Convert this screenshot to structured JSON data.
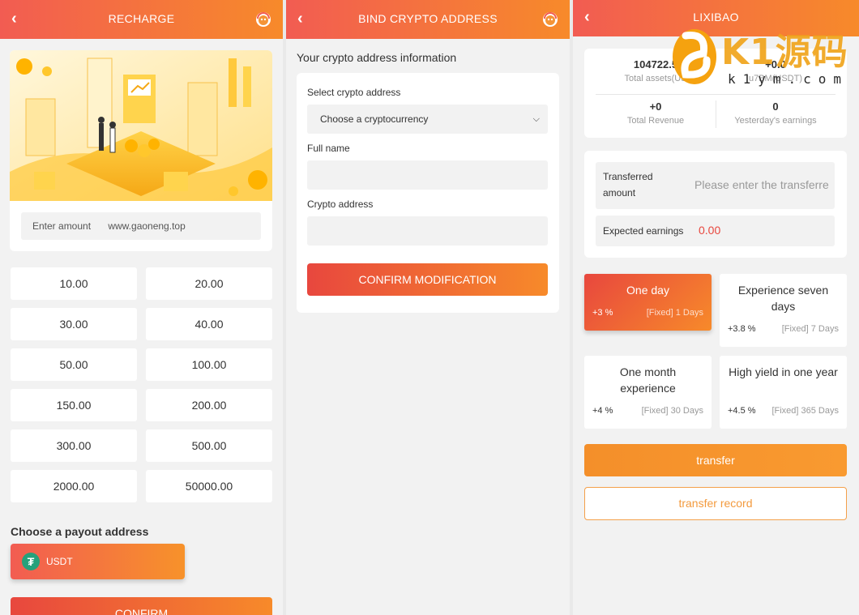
{
  "recharge": {
    "title": "RECHARGE",
    "amount_label": "Enter amount",
    "amount_value": "www.gaoneng.top",
    "amounts": [
      "10.00",
      "20.00",
      "30.00",
      "40.00",
      "50.00",
      "100.00",
      "150.00",
      "200.00",
      "300.00",
      "500.00",
      "2000.00",
      "50000.00"
    ],
    "payout_label": "Choose a payout address",
    "payout_option": "USDT",
    "confirm_label": "CONFIRM"
  },
  "bind": {
    "title": "BIND CRYPTO ADDRESS",
    "info_title": "Your crypto address information",
    "select_label": "Select crypto address",
    "select_value": "Choose a cryptocurrency",
    "name_label": "Full name",
    "name_value": "",
    "address_label": "Crypto address",
    "address_value": "",
    "confirm_label": "CONFIRM MODIFICATION"
  },
  "lixibao": {
    "title": "LIXIBAO",
    "total_assets_value": "104722.5",
    "total_assets_label": "Total assets(US",
    "yesterday_value": "+0.0",
    "yesterday_label": "u7BM(USDT)",
    "total_revenue_value": "+0",
    "total_revenue_label": "Total Revenue",
    "yesterday_earnings_value": "0",
    "yesterday_earnings_label": "Yesterday's earnings",
    "transferred_label_1": "Transferred",
    "transferred_label_2": "amount",
    "transferred_placeholder": "Please enter the transferre",
    "expected_label": "Expected earnings",
    "expected_value": "0.00",
    "plans": [
      {
        "name": "One day",
        "rate": "+3 %",
        "detail": "[Fixed] 1 Days"
      },
      {
        "name": "Experience seven days",
        "rate": "+3.8 %",
        "detail": "[Fixed] 7 Days"
      },
      {
        "name": "One month experience",
        "rate": "+4 %",
        "detail": "[Fixed] 30 Days"
      },
      {
        "name": "High yield in one year",
        "rate": "+4.5 %",
        "detail": "[Fixed] 365 Days"
      }
    ],
    "transfer_label": "transfer",
    "record_label": "transfer record"
  },
  "icons": {
    "back": "chevron-left-icon",
    "service": "customer-service-icon",
    "coin": "tether-icon",
    "dropdown": "chevron-down-icon"
  },
  "colors": {
    "header_start": "#f25c52",
    "header_end": "#f78a2a",
    "tether": "#26a17b",
    "expected_value": "#e8473e"
  },
  "watermark": {
    "text": "K1源码",
    "sub": "k1ym.com"
  }
}
